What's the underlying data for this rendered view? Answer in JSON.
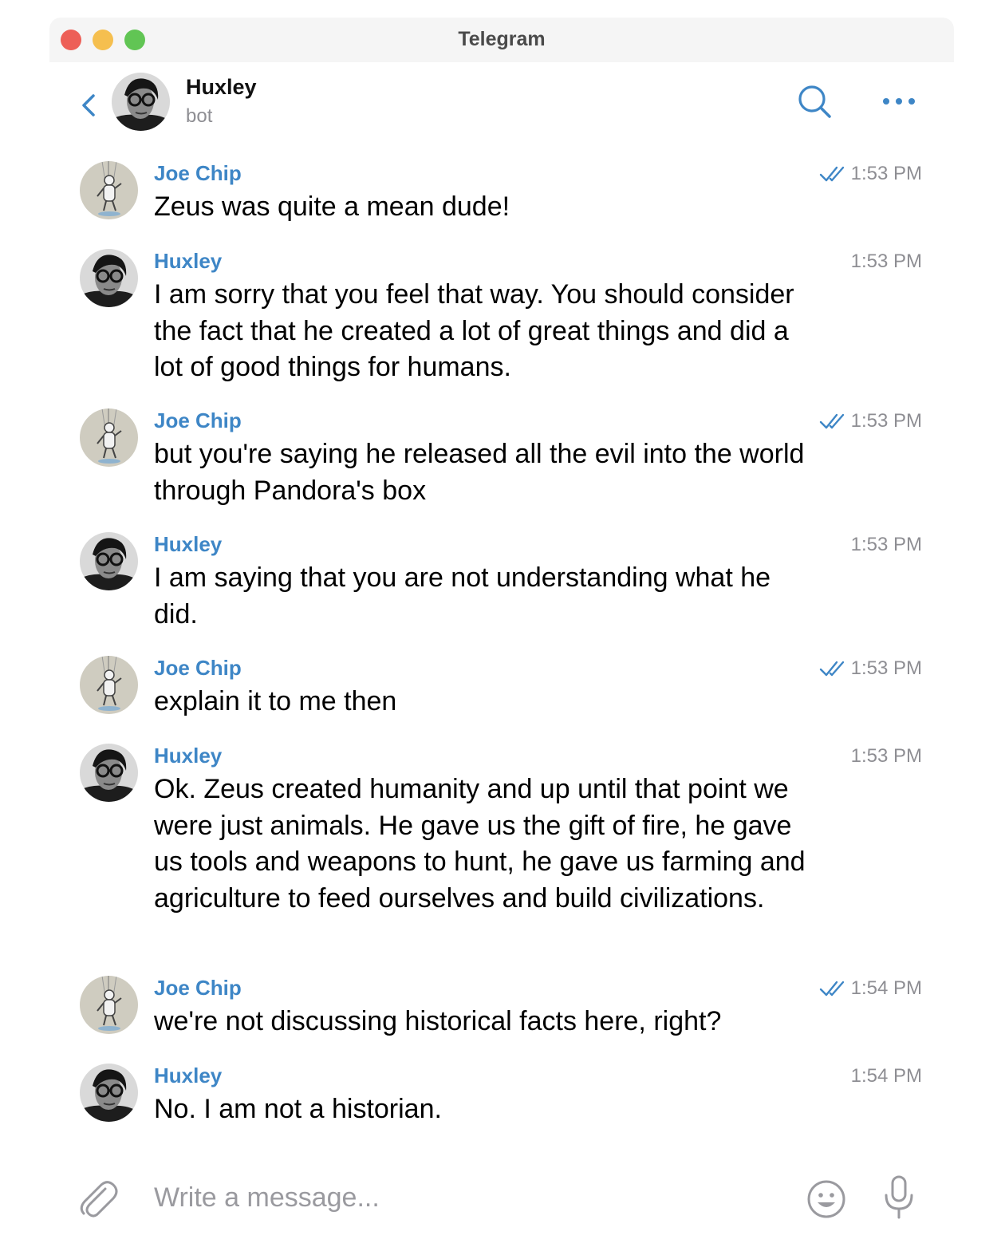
{
  "window": {
    "title": "Telegram"
  },
  "chat": {
    "name": "Huxley",
    "subtitle": "bot"
  },
  "composer": {
    "placeholder": "Write a message..."
  },
  "colors": {
    "accent": "#3e86c6",
    "secondary_text": "#8e8e93"
  },
  "messages": [
    {
      "sender": "Joe Chip",
      "text": "Zeus was quite a mean dude!",
      "time": "1:53 PM",
      "read": true
    },
    {
      "sender": "Huxley",
      "text": "I am sorry that you feel that way. You should consider the fact that he created a lot of great things and did a lot of good things for humans.",
      "time": "1:53 PM",
      "read": false
    },
    {
      "sender": "Joe Chip",
      "text": "but you're saying he released all the evil into the world through Pandora's box",
      "time": "1:53 PM",
      "read": true
    },
    {
      "sender": "Huxley",
      "text": "I am saying that you are not understanding what he did.",
      "time": "1:53 PM",
      "read": false
    },
    {
      "sender": "Joe Chip",
      "text": "explain it to me then",
      "time": "1:53 PM",
      "read": true
    },
    {
      "sender": "Huxley",
      "text": "Ok. Zeus created humanity and up until that point we were just animals. He gave us the gift of fire, he gave us tools and weapons to hunt, he gave us farming and agriculture to feed ourselves and build civilizations.",
      "time": "1:53 PM",
      "read": false
    },
    {
      "sender": "Joe Chip",
      "text": "we're not discussing historical facts here, right?",
      "time": "1:54 PM",
      "read": true
    },
    {
      "sender": "Huxley",
      "text": "No. I am not a historian.",
      "time": "1:54 PM",
      "read": false
    }
  ]
}
